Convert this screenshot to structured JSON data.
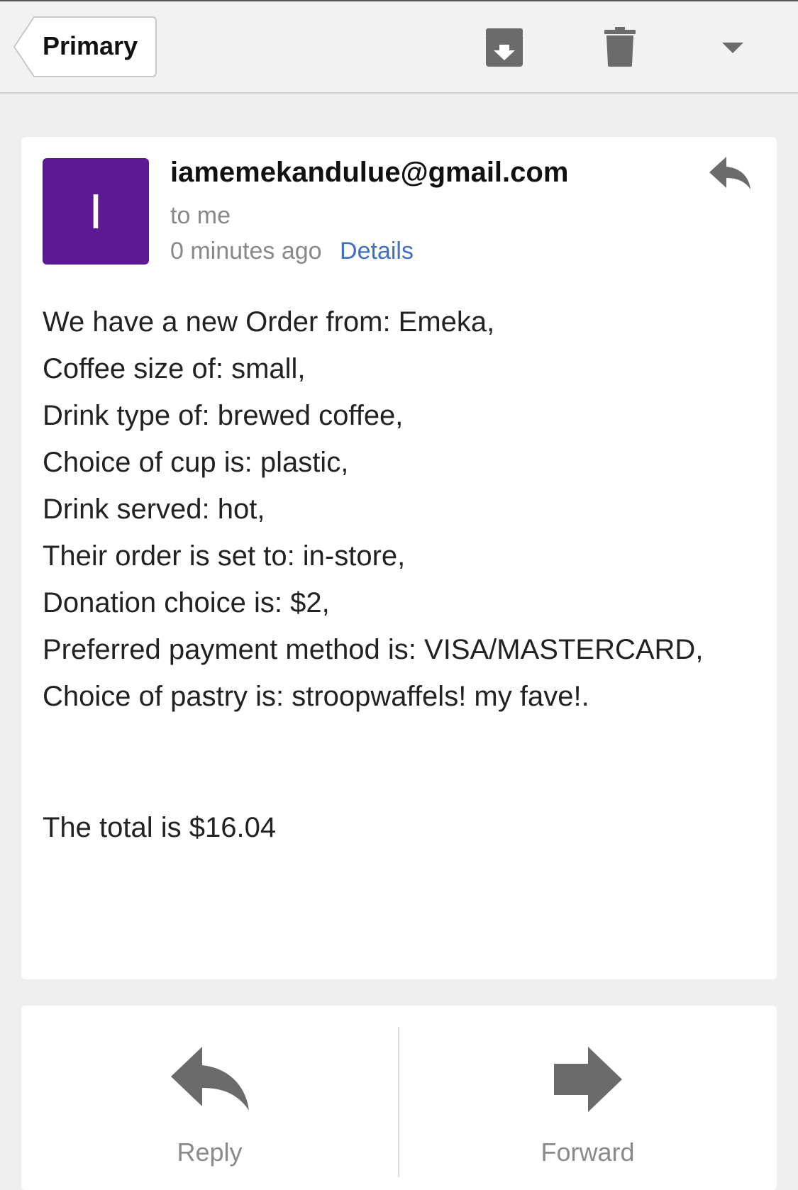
{
  "toolbar": {
    "back_label": "Primary",
    "archive_icon": "archive-icon",
    "trash_icon": "trash-icon",
    "more_icon": "caret-down-icon"
  },
  "message": {
    "avatar_letter": "I",
    "avatar_color": "#5b1a93",
    "sender": "iamemekandulue@gmail.com",
    "recipient": "to me",
    "time": "0 minutes ago",
    "details_link": "Details",
    "reply_icon": "reply-icon",
    "body_lines": [
      "We have a new Order from: Emeka,",
      "Coffee size of: small,",
      "Drink type of: brewed coffee,",
      "Choice of cup is: plastic,",
      "Drink served: hot,",
      "Their order is set to: in-store,",
      "Donation choice is: $2,",
      "Preferred payment method is: VISA/MASTERCARD,",
      "Choice of pastry is: stroopwaffels! my fave!."
    ],
    "total": "The total is $16.04"
  },
  "actions": {
    "reply_label": "Reply",
    "forward_label": "Forward"
  },
  "colors": {
    "link": "#3f6fc2",
    "icon": "#6b6b6b"
  }
}
